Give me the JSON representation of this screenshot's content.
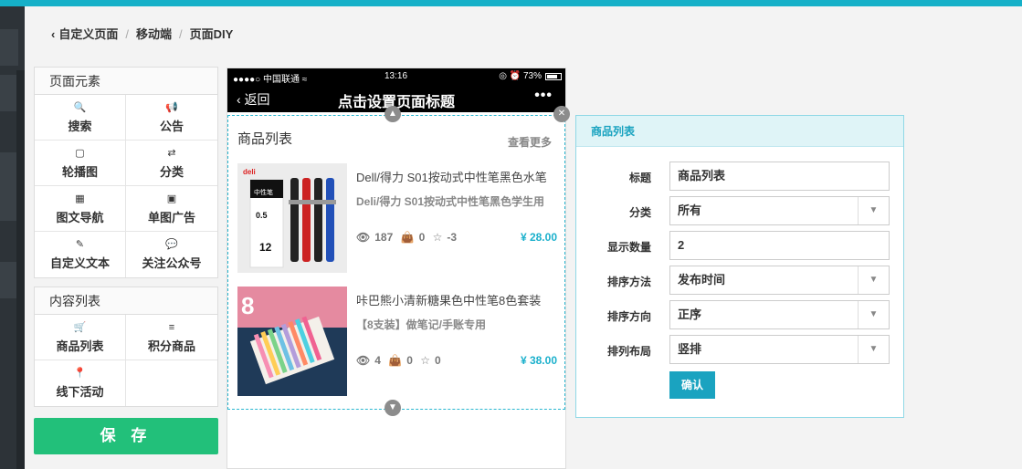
{
  "breadcrumb": {
    "back_icon": "‹",
    "items": [
      "自定义页面",
      "移动端",
      "页面DIY"
    ],
    "sep": "/"
  },
  "elements_panel": {
    "title": "页面元素",
    "items": [
      {
        "label": "搜索",
        "icon": "search-icon",
        "glyph": "🔍"
      },
      {
        "label": "公告",
        "icon": "bullhorn-icon",
        "glyph": "📢"
      },
      {
        "label": "轮播图",
        "icon": "file-image-icon",
        "glyph": "▢"
      },
      {
        "label": "分类",
        "icon": "exchange-icon",
        "glyph": "⇄"
      },
      {
        "label": "图文导航",
        "icon": "grid-icon",
        "glyph": "▦"
      },
      {
        "label": "单图广告",
        "icon": "picture-icon",
        "glyph": "▣"
      },
      {
        "label": "自定义文本",
        "icon": "edit-icon",
        "glyph": "✎"
      },
      {
        "label": "关注公众号",
        "icon": "wechat-icon",
        "glyph": "💬"
      }
    ]
  },
  "content_panel": {
    "title": "内容列表",
    "items": [
      {
        "label": "商品列表",
        "icon": "cart-icon",
        "glyph": "🛒"
      },
      {
        "label": "积分商品",
        "icon": "database-icon",
        "glyph": "≡"
      },
      {
        "label": "线下活动",
        "icon": "map-marker-icon",
        "glyph": "📍"
      }
    ]
  },
  "save_label": "保 存",
  "phone": {
    "status_left": "●●●●○ 中国联通 ≈",
    "status_time": "13:16",
    "status_right": "◎ ⏰ 73%",
    "nav_back": "‹ 返回",
    "nav_title": "点击设置页面标题",
    "nav_more": "•••",
    "section_title": "商品列表",
    "see_more": "查看更多",
    "goods": [
      {
        "name": "Dell/得力 S01按动式中性笔黑色水笔",
        "desc": "Deli/得力 S01按动式中性笔黑色学生用",
        "views": "187",
        "bag": "0",
        "stars": "-3",
        "price": "¥ 28.00"
      },
      {
        "name": "咔巴熊小清新糖果色中性笔8色套装",
        "desc": "【8支装】做笔记/手账专用",
        "views": "4",
        "bag": "0",
        "stars": "0",
        "price": "¥ 38.00"
      }
    ]
  },
  "form": {
    "header": "商品列表",
    "rows": [
      {
        "label": "标题",
        "value": "商品列表",
        "type": "input"
      },
      {
        "label": "分类",
        "value": "所有",
        "type": "select"
      },
      {
        "label": "显示数量",
        "value": "2",
        "type": "input"
      },
      {
        "label": "排序方法",
        "value": "发布时间",
        "type": "select"
      },
      {
        "label": "排序方向",
        "value": "正序",
        "type": "select"
      },
      {
        "label": "排列布局",
        "value": "竖排",
        "type": "select"
      }
    ],
    "confirm": "确认"
  },
  "colors": {
    "accent": "#15b0c8",
    "save": "#22c07a",
    "price": "#1bb0cc"
  }
}
